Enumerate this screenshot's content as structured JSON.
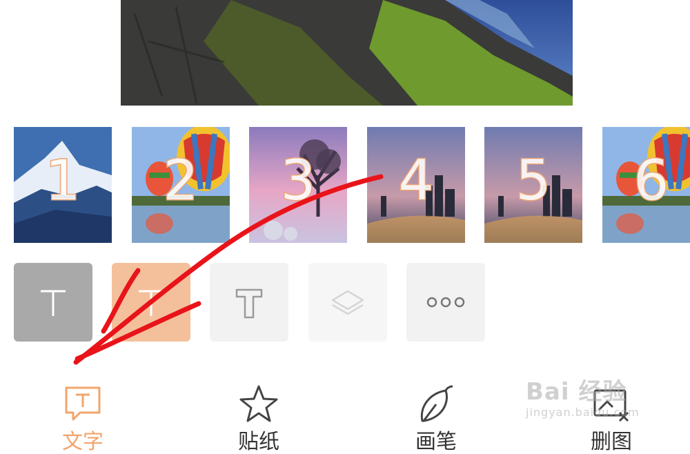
{
  "preview": {
    "icon": "mountain-photo"
  },
  "thumbnails": [
    {
      "number": "1",
      "scene": "snowy-mountain",
      "selected": true
    },
    {
      "number": "2",
      "scene": "hot-air-balloons-lake",
      "selected": false
    },
    {
      "number": "3",
      "scene": "lone-tree-sunset",
      "selected": false
    },
    {
      "number": "4",
      "scene": "city-skyline-dusk",
      "selected": false
    },
    {
      "number": "5",
      "scene": "city-skyline-dusk",
      "selected": false
    },
    {
      "number": "6",
      "scene": "hot-air-balloons-lake",
      "selected": false
    }
  ],
  "tools": [
    {
      "icon": "text-icon",
      "style": "gray-filled"
    },
    {
      "icon": "text-icon",
      "style": "orange-filled"
    },
    {
      "icon": "text-outline-icon",
      "style": "light"
    },
    {
      "icon": "layers-icon",
      "style": "disabled"
    },
    {
      "icon": "more-icon",
      "style": "light"
    }
  ],
  "tabs": [
    {
      "label": "文字",
      "icon": "text-bubble-icon",
      "active": true
    },
    {
      "label": "贴纸",
      "icon": "star-icon",
      "active": false
    },
    {
      "label": "画笔",
      "icon": "brush-leaf-icon",
      "active": false
    },
    {
      "label": "删图",
      "icon": "delete-image-icon",
      "active": false
    }
  ],
  "watermark": {
    "main": "Bai 经验",
    "sub": "jingyan.baidu.com"
  },
  "colors": {
    "accent": "#f2a46a",
    "annotation": "#e8141a"
  }
}
